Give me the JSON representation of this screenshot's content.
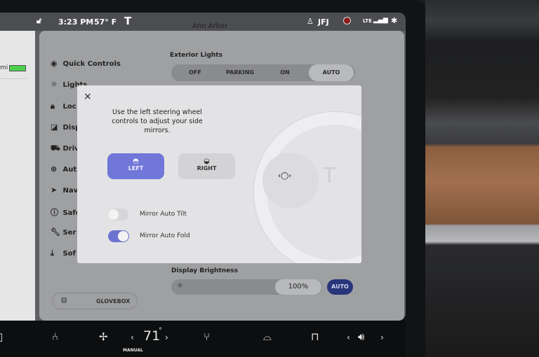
{
  "status": {
    "time": "3:23 PM",
    "temp": "57° F",
    "map_label": "Ann Arbor",
    "user": "JFJ",
    "network": "LTE"
  },
  "left_pane": {
    "range_suffix": "mi"
  },
  "sidebar": {
    "items": [
      {
        "label": "Quick Controls",
        "icon": "toggle-icon"
      },
      {
        "label": "Lights",
        "icon": "sun-icon"
      },
      {
        "label": "Loc",
        "icon": "lock-icon"
      },
      {
        "label": "Disp",
        "icon": "display-icon"
      },
      {
        "label": "Driv",
        "icon": "car-icon"
      },
      {
        "label": "Aut",
        "icon": "steering-wheel-icon"
      },
      {
        "label": "Nav",
        "icon": "navigation-icon"
      },
      {
        "label": "Safe",
        "icon": "alert-icon"
      },
      {
        "label": "Ser",
        "icon": "wrench-icon"
      },
      {
        "label": "Sof",
        "icon": "download-icon"
      }
    ],
    "glovebox": "GLOVEBOX"
  },
  "exterior_lights": {
    "title": "Exterior Lights",
    "options": [
      "OFF",
      "PARKING",
      "ON",
      "AUTO"
    ],
    "selected": "AUTO"
  },
  "brightness": {
    "title": "Display Brightness",
    "value": "100%",
    "level_percent": 100,
    "auto": "AUTO"
  },
  "modal": {
    "instruction": "Use the left steering wheel controls to adjust your side mirrors.",
    "left": "LEFT",
    "right": "RIGHT",
    "selected": "LEFT",
    "toggles": [
      {
        "label": "Mirror Auto Tilt",
        "on": false
      },
      {
        "label": "Mirror Auto Fold",
        "on": true
      }
    ]
  },
  "climate": {
    "temperature": "71",
    "unit": "°",
    "mode": "MANUAL"
  },
  "colors": {
    "accent": "#7077d8",
    "auto_button": "#27357a"
  }
}
